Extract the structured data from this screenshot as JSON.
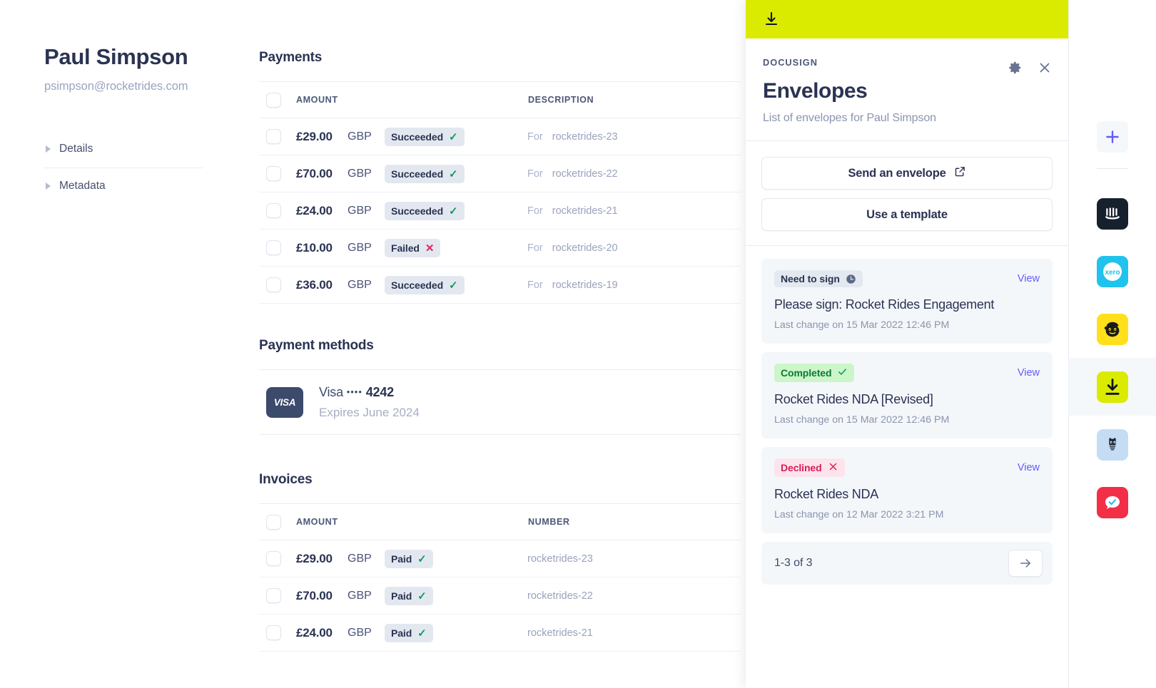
{
  "customer": {
    "name": "Paul Simpson",
    "email": "psimpson@rocketrides.com",
    "accordions": [
      {
        "label": "Details"
      },
      {
        "label": "Metadata"
      }
    ]
  },
  "payments": {
    "title": "Payments",
    "columns": {
      "amount": "AMOUNT",
      "description": "DESCRIPTION"
    },
    "rows": [
      {
        "amount": "£29.00",
        "currency": "GBP",
        "status": "Succeeded",
        "status_icon": "check",
        "for_label": "For",
        "description": "rocketrides-23"
      },
      {
        "amount": "£70.00",
        "currency": "GBP",
        "status": "Succeeded",
        "status_icon": "check",
        "for_label": "For",
        "description": "rocketrides-22"
      },
      {
        "amount": "£24.00",
        "currency": "GBP",
        "status": "Succeeded",
        "status_icon": "check",
        "for_label": "For",
        "description": "rocketrides-21"
      },
      {
        "amount": "£10.00",
        "currency": "GBP",
        "status": "Failed",
        "status_icon": "cross",
        "for_label": "For",
        "description": "rocketrides-20"
      },
      {
        "amount": "£36.00",
        "currency": "GBP",
        "status": "Succeeded",
        "status_icon": "check",
        "for_label": "For",
        "description": "rocketrides-19"
      }
    ]
  },
  "payment_methods": {
    "title": "Payment methods",
    "card": {
      "brand_logo": "VISA",
      "brand": "Visa",
      "dots": "••••",
      "last4": "4242",
      "expires": "Expires June 2024"
    }
  },
  "invoices": {
    "title": "Invoices",
    "columns": {
      "amount": "AMOUNT",
      "number": "NUMBER"
    },
    "rows": [
      {
        "amount": "£29.00",
        "currency": "GBP",
        "status": "Paid",
        "status_icon": "check",
        "number": "rocketrides-23"
      },
      {
        "amount": "£70.00",
        "currency": "GBP",
        "status": "Paid",
        "status_icon": "check",
        "number": "rocketrides-22"
      },
      {
        "amount": "£24.00",
        "currency": "GBP",
        "status": "Paid",
        "status_icon": "check",
        "number": "rocketrides-21"
      }
    ]
  },
  "panel": {
    "topbar_icon": "download-icon",
    "topbar_color": "#dbeb00",
    "kicker": "DOCUSIGN",
    "title": "Envelopes",
    "subtitle": "List of envelopes for Paul Simpson",
    "settings_icon": "gear-icon",
    "close_icon": "close-icon",
    "actions": [
      {
        "label": "Send an envelope",
        "icon": "external-link-icon"
      },
      {
        "label": "Use a template",
        "icon": null
      }
    ],
    "envelopes": [
      {
        "status": "Need to sign",
        "status_icon": "clock",
        "status_style": "grey",
        "view_label": "View",
        "title": "Please sign: Rocket Rides Engagement",
        "meta": "Last change on 15 Mar 2022 12:46 PM"
      },
      {
        "status": "Completed",
        "status_icon": "check",
        "status_style": "green",
        "view_label": "View",
        "title": "Rocket Rides NDA [Revised]",
        "meta": "Last change on 15 Mar 2022 12:46 PM"
      },
      {
        "status": "Declined",
        "status_icon": "cross",
        "status_style": "red",
        "view_label": "View",
        "title": "Rocket Rides NDA",
        "meta": "Last change on 12 Mar 2022 3:21 PM"
      }
    ],
    "pagination": {
      "range": "1-3 of 3",
      "next_icon": "arrow-right-icon"
    }
  },
  "rail": {
    "add_icon": "plus-icon",
    "add_color": "#635bff",
    "apps": [
      {
        "name": "intercom-icon",
        "bg": "#17212e",
        "active": false
      },
      {
        "name": "xero-icon",
        "bg": "#20c3ec",
        "active": false
      },
      {
        "name": "mailchimp-icon",
        "bg": "#ffe01b",
        "active": false
      },
      {
        "name": "docusign-icon",
        "bg": "#dbeb00",
        "active": true
      },
      {
        "name": "hootsuite-icon",
        "bg": "#c5dcf5",
        "active": false
      },
      {
        "name": "twilio-icon",
        "bg": "#f22f46",
        "active": false
      }
    ]
  },
  "colors": {
    "accent": "#635bff",
    "success": "#0f9d58",
    "danger": "#e0245e",
    "docusign_yellow": "#dbeb00"
  }
}
